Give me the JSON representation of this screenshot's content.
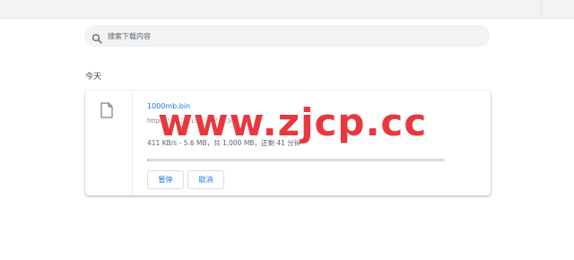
{
  "search": {
    "placeholder": "搜索下载内容"
  },
  "sections": [
    {
      "date": "今天",
      "downloads": [
        {
          "filename": "1000mb.bin",
          "url": "http://185.22.191.30/1000mb.bin",
          "status": "411 KB/s - 5.6 MB，共 1,000 MB，还剩 41 分钟",
          "progress_fraction": 0.0056,
          "actions": {
            "pause_label": "暂停",
            "cancel_label": "取消"
          }
        }
      ]
    }
  ],
  "watermark": {
    "text": "www.zjcp.cc",
    "color": "#e8383d"
  },
  "colors": {
    "accent": "#1a73e8",
    "search_background": "#f1f3f4"
  }
}
